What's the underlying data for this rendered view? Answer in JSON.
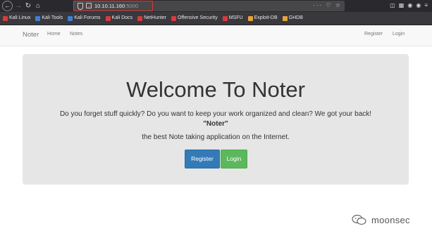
{
  "browser": {
    "url_host": "10.10.11.160",
    "url_port": ":5000",
    "url_actions": "··· ♡ ☆",
    "nav": {
      "back_icon": "arrow-left-icon",
      "forward_icon": "arrow-right-icon",
      "reload_icon": "reload-icon",
      "home_icon": "home-icon"
    },
    "toolbar_icons": [
      "library-icon",
      "sidebar-icon",
      "firefox-account-icon",
      "extension-icon",
      "menu-icon"
    ]
  },
  "bookmarks": [
    {
      "label": "Kali Linux",
      "color": "#d93a3a"
    },
    {
      "label": "Kali Tools",
      "color": "#3f7fd6"
    },
    {
      "label": "Kali Forums",
      "color": "#3f7fd6"
    },
    {
      "label": "Kali Docs",
      "color": "#d93a3a"
    },
    {
      "label": "NetHunter",
      "color": "#d93a3a"
    },
    {
      "label": "Offensive Security",
      "color": "#d93a3a"
    },
    {
      "label": "MSFU",
      "color": "#d93a3a"
    },
    {
      "label": "Exploit-DB",
      "color": "#e8a33c"
    },
    {
      "label": "GHDB",
      "color": "#e8a33c"
    }
  ],
  "navbar": {
    "brand": "Noter",
    "home": "Home",
    "notes": "Notes",
    "register": "Register",
    "login": "Login"
  },
  "hero": {
    "title": "Welcome To Noter",
    "tagline": "Do you forget stuff quickly? Do you want to keep your work organized and clean? We got your back!",
    "brand_quote": "\"Noter\"",
    "subtitle": "the best Note taking application on the Internet.",
    "register_label": "Register",
    "login_label": "Login"
  },
  "watermark": {
    "text": "moonsec"
  },
  "colors": {
    "primary": "#337ab7",
    "success": "#5cb85c",
    "jumbotron": "#e6e6e6",
    "url_highlight": "#e03535"
  }
}
